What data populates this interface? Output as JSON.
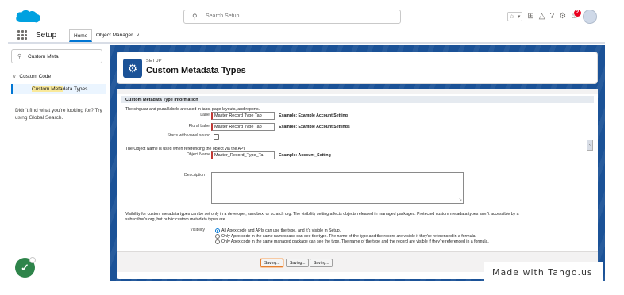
{
  "header": {
    "search_placeholder": "Search Setup",
    "notification_count": "2",
    "icons": [
      "star-icon",
      "favorites-dropdown-icon",
      "add-icon",
      "trailhead-icon",
      "help-icon",
      "gear-icon",
      "bell-icon",
      "avatar"
    ]
  },
  "nav": {
    "app_name": "Setup",
    "tabs": [
      {
        "label": "Home",
        "active": true
      },
      {
        "label": "Object Manager",
        "has_dropdown": true
      }
    ]
  },
  "sidebar": {
    "quick_find_value": "Custom Meta",
    "tree_parent": "Custom Code",
    "tree_child_prefix": "Custom Meta",
    "tree_child_rest": "data Types",
    "help_text": "Didn't find what you're looking for? Try using Global Search."
  },
  "page": {
    "breadcrumb": "SETUP",
    "title": "Custom Metadata Types"
  },
  "form": {
    "section_title": "Custom Metadata Type Information",
    "intro_text": "The singular and plural labels are used in tabs, page layouts, and reports.",
    "label_field": {
      "label": "Label",
      "value": "Master Record Type Tab",
      "example_prefix": "Example:",
      "example": "Example Account Setting"
    },
    "plural_field": {
      "label": "Plural Label",
      "value": "Master Record Type Tab",
      "example_prefix": "Example:",
      "example": "Example Account Settings"
    },
    "vowel_field": {
      "label": "Starts with vowel sound"
    },
    "object_name_intro": "The Object Name is used when referencing the object via the API.",
    "object_name_field": {
      "label": "Object Name",
      "value": "Master_Record_Type_Ta",
      "example_prefix": "Example:",
      "example": "Account_Setting"
    },
    "description_label": "Description",
    "visibility_text_1": "Visibility for custom metadata types can be set only in a developer, sandbox, or scratch org. The visibility setting affects objects released in managed packages. Protected custom metadata types aren't accessible by a",
    "visibility_text_2": "subscriber's org, but public custom metadata types are.",
    "visibility_label": "Visibility",
    "visibility_options": [
      {
        "label": "All Apex code and APIs can use the type, and it's visible in Setup.",
        "selected": true
      },
      {
        "label": "Only Apex code in the same namespace can see the type. The name of the type and the record are visible if they're referenced in a formula.",
        "selected": false
      },
      {
        "label": "Only Apex code in the same managed package can see the type. The name of the type and the record are visible if they're referenced in a formula.",
        "selected": false
      }
    ],
    "buttons": {
      "save": "Saving...",
      "save_new": "Saving...",
      "cancel": "Saving..."
    }
  },
  "watermark": "Made with Tango.us",
  "colors": {
    "brand_blue": "#1b5297",
    "accent": "#0176d3",
    "required": "#c23934",
    "success": "#2e844a",
    "focus": "#e57f2f"
  }
}
